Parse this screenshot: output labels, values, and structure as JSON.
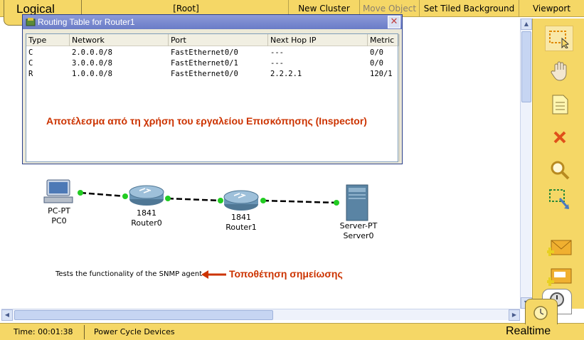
{
  "topbar": {
    "logical_tab": "Logical",
    "root": "[Root]",
    "new_cluster": "New Cluster",
    "move_object": "Move Object",
    "set_tiled_background": "Set Tiled Background",
    "viewport": "Viewport"
  },
  "routing_window": {
    "title": "Routing Table for Router1",
    "close": "✕",
    "columns": [
      "Type",
      "Network",
      "Port",
      "Next Hop IP",
      "Metric"
    ],
    "rows": [
      [
        "C",
        "2.0.0.0/8",
        "FastEthernet0/0",
        "---",
        "0/0"
      ],
      [
        "C",
        "3.0.0.0/8",
        "FastEthernet0/1",
        "---",
        "0/0"
      ],
      [
        "R",
        "1.0.0.0/8",
        "FastEthernet0/0",
        "2.2.2.1",
        "120/1"
      ]
    ]
  },
  "annotations": {
    "inspector_caption": "Αποτέλεσμα από τη χρήση του εργαλείου Επισκόπησης (Inspector)",
    "note_text": "Tests the functionality of the SNMP agent",
    "note_caption": "Τοποθέτηση σημείωσης"
  },
  "devices": {
    "pc": {
      "model": "PC-PT",
      "name": "PC0"
    },
    "router0": {
      "model": "1841",
      "name": "Router0"
    },
    "router1": {
      "model": "1841",
      "name": "Router1"
    },
    "server": {
      "model": "Server-PT",
      "name": "Server0"
    }
  },
  "bottombar": {
    "time": "Time: 00:01:38",
    "power_cycle": "Power Cycle Devices",
    "realtime": "Realtime"
  },
  "colors": {
    "toolbar_yellow": "#f5d766",
    "annotation_red": "#cc3300",
    "link_green": "#22cc22",
    "titlebar_blue": "#6a7cc7"
  },
  "icons": [
    "select-icon",
    "hand-icon",
    "note-icon",
    "delete-icon",
    "zoom-icon",
    "resize-icon",
    "simple-pdu-icon",
    "complex-pdu-icon",
    "clock-icon",
    "timer-icon"
  ]
}
